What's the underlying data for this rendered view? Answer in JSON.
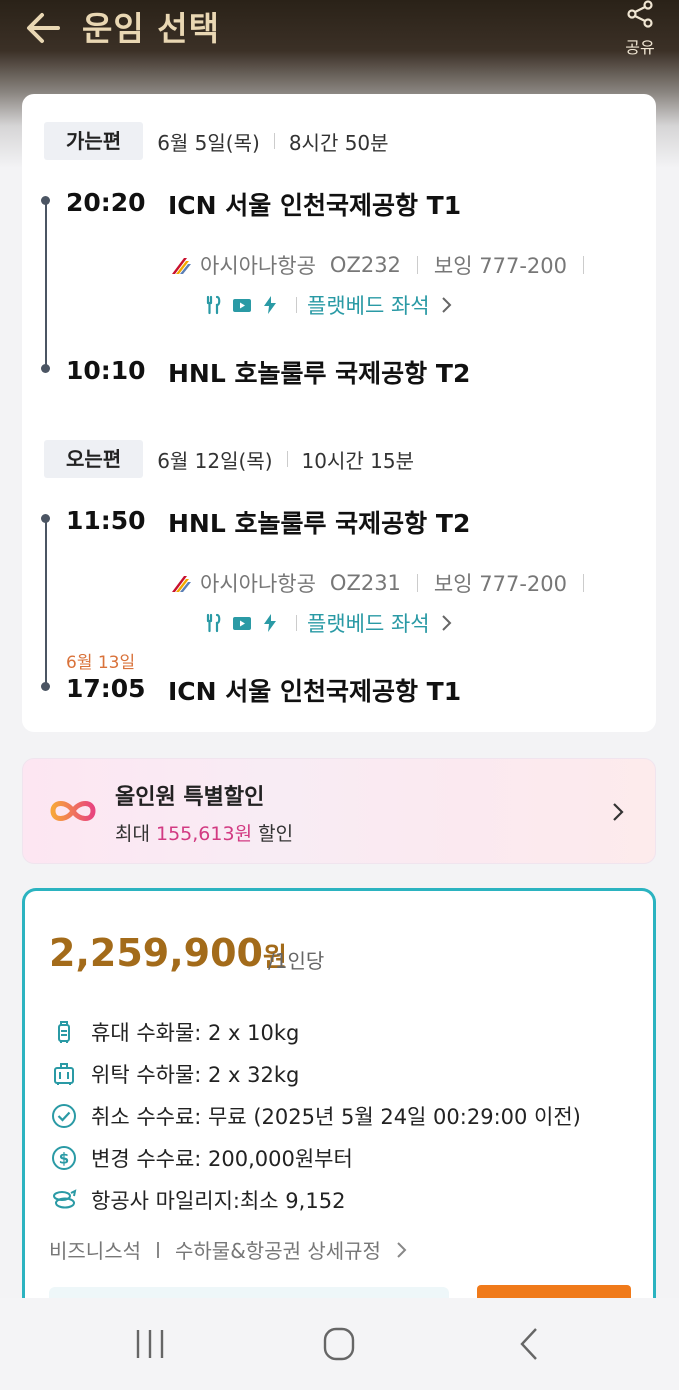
{
  "header": {
    "title": "운임 선택",
    "share_label": "공유"
  },
  "outbound": {
    "label": "가는편",
    "date": "6월 5일(목)",
    "duration": "8시간 50분",
    "depart_time": "20:20",
    "depart_airport": "ICN 서울 인천국제공항 T1",
    "airline": "아시아나항공",
    "flight_no": "OZ232",
    "aircraft": "보잉 777-200",
    "seat_type": "플랫베드 좌석",
    "arrive_time": "10:10",
    "arrive_airport": "HNL 호놀룰루 국제공항 T2"
  },
  "inbound": {
    "label": "오는편",
    "date": "6월 12일(목)",
    "duration": "10시간 15분",
    "depart_time": "11:50",
    "depart_airport": "HNL 호놀룰루 국제공항 T2",
    "airline": "아시아나항공",
    "flight_no": "OZ231",
    "aircraft": "보잉 777-200",
    "seat_type": "플랫베드 좌석",
    "arrive_date_note": "6월 13일",
    "arrive_time": "17:05",
    "arrive_airport": "ICN 서울 인천국제공항 T1"
  },
  "promo": {
    "title": "올인원 특별할인",
    "prefix": "최대 ",
    "amount": "155,613원",
    "suffix": " 할인"
  },
  "fare": {
    "price": "2,259,900",
    "currency": "원",
    "per_person": "/1인당",
    "rules": [
      {
        "icon": "carry-on-bag-icon",
        "text": "휴대 수화물: 2 x 10kg"
      },
      {
        "icon": "checked-bag-icon",
        "text": "위탁 수하물: 2 x 32kg"
      },
      {
        "icon": "check-circle-icon",
        "text": "취소 수수료: 무료 (2025년 5월 24일 00:29:00 이전)"
      },
      {
        "icon": "dollar-circle-icon",
        "text": "변경 수수료: 200,000원부터"
      },
      {
        "icon": "mileage-icon",
        "text": "항공사 마일리지:최소 9,152"
      }
    ],
    "cabin_class": "비즈니스석",
    "detail_link": "수하물&항공권 상세규정"
  },
  "colors": {
    "accent_teal": "#2bb3c0",
    "price_gold": "#a36b1a",
    "promo_pink": "#d23a82",
    "next_day_orange": "#d9723a"
  }
}
